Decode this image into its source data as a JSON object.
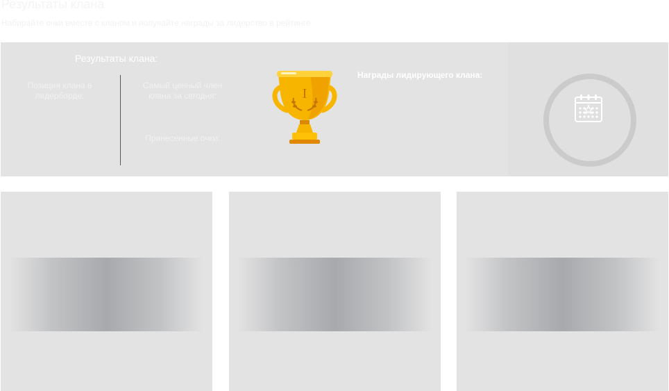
{
  "header": {
    "title": "Результаты клана",
    "subtitle": "Набирайте очки вместе с кланом и получайте награды за лидерство в рейтинге"
  },
  "results": {
    "title": "Результаты клана:",
    "position_label": "Позиция клана в лидерборде:",
    "valuable_member_label": "Самый ценный член клана за сегодня:",
    "points_label": "Принесенные очки:",
    "rewards_title": "Награды лидирующего клана:"
  },
  "icons": {
    "trophy": "trophy-icon",
    "calendar": "calendar-icon"
  },
  "colors": {
    "panel_background": "#e3e3e3",
    "trophy_gold": "#f7b500",
    "trophy_dark": "#e08800",
    "skeleton": "#a7a9ac"
  },
  "cards": [
    {
      "state": "loading"
    },
    {
      "state": "loading"
    },
    {
      "state": "loading"
    }
  ]
}
